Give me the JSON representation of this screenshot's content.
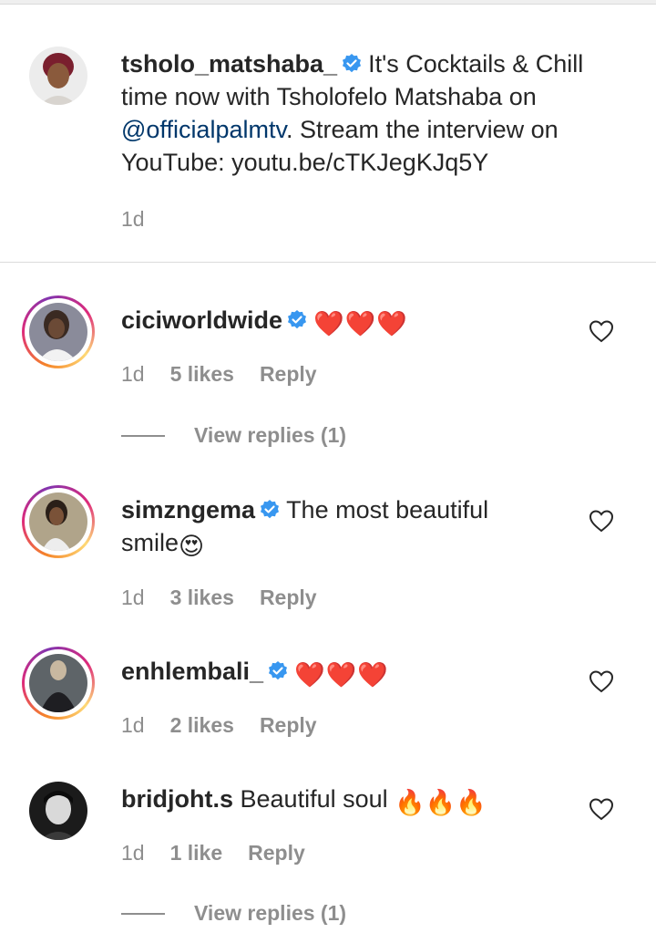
{
  "caption": {
    "username": "tsholo_matshaba_",
    "text": "It's Cocktails & Chill",
    "line2": "time now with Tsholofelo Matshaba on",
    "mention": "@officialpalmtv",
    "line3_rest": ". Stream the interview on",
    "line4": "YouTube: youtu.be/cTKJegKJq5Y",
    "time": "1d"
  },
  "comments": [
    {
      "username": "ciciworldwide",
      "emoji": "❤️❤️❤️",
      "time": "1d",
      "likes": "5 likes",
      "reply": "Reply",
      "view_replies": "View replies (1)"
    },
    {
      "username": "simzngema",
      "text_line1": "The most beautiful",
      "text_line2": "smile",
      "emoji": "😍",
      "time": "1d",
      "likes": "3 likes",
      "reply": "Reply"
    },
    {
      "username": "enhlembali_",
      "emoji": "❤️❤️❤️",
      "time": "1d",
      "likes": "2 likes",
      "reply": "Reply"
    },
    {
      "username": "bridjoht.s",
      "text": "Beautiful soul",
      "emoji": "🔥🔥🔥",
      "time": "1d",
      "likes": "1 like",
      "reply": "Reply",
      "view_replies": "View replies (1)"
    }
  ],
  "icons": {
    "verified": "verified-badge-icon",
    "heart": "heart-outline-icon"
  },
  "colors": {
    "verified_blue": "#3897f0",
    "link": "#00376b",
    "meta_gray": "#8e8e8e",
    "heart_red": "#e0162b"
  }
}
